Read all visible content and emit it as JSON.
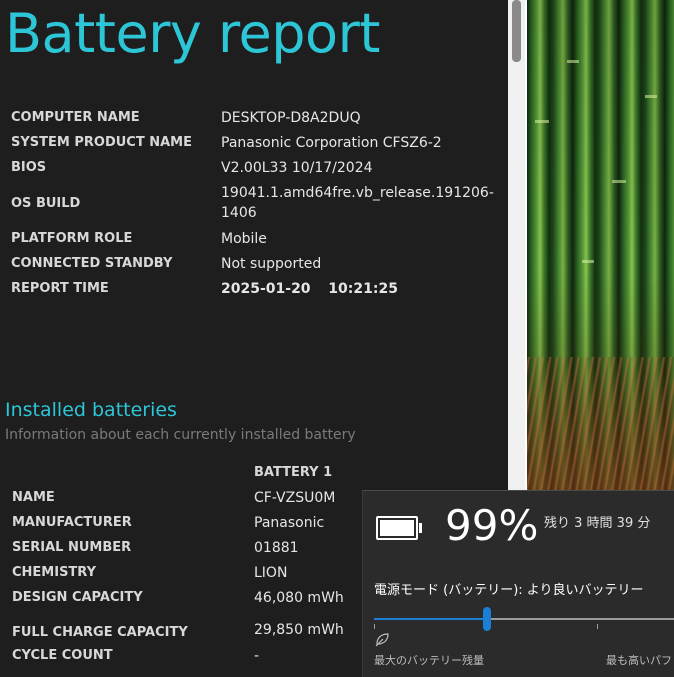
{
  "report": {
    "title": "Battery report",
    "system_info": [
      {
        "label": "COMPUTER NAME",
        "value": "DESKTOP-D8A2DUQ"
      },
      {
        "label": "SYSTEM PRODUCT NAME",
        "value": "Panasonic Corporation CFSZ6-2"
      },
      {
        "label": "BIOS",
        "value": "V2.00L33 10/17/2024"
      },
      {
        "label": "OS BUILD",
        "value": "19041.1.amd64fre.vb_release.191206-1406"
      },
      {
        "label": "PLATFORM ROLE",
        "value": "Mobile"
      },
      {
        "label": "CONNECTED STANDBY",
        "value": "Not supported"
      },
      {
        "label": "REPORT TIME",
        "value": "2025-01-20  10:21:25"
      }
    ],
    "installed_batteries": {
      "title": "Installed batteries",
      "subtitle": "Information about each currently installed battery",
      "column_header": "BATTERY 1",
      "rows": [
        {
          "label": "NAME",
          "value": "CF-VZSU0M"
        },
        {
          "label": "MANUFACTURER",
          "value": "Panasonic"
        },
        {
          "label": "SERIAL NUMBER",
          "value": "01881"
        },
        {
          "label": "CHEMISTRY",
          "value": "LION"
        },
        {
          "label": "DESIGN CAPACITY",
          "value": "46,080 mWh"
        },
        {
          "label": "FULL CHARGE CAPACITY",
          "value": "29,850 mWh"
        },
        {
          "label": "CYCLE COUNT",
          "value": "-"
        }
      ]
    }
  },
  "battery_flyout": {
    "percent": "99%",
    "percent_value": 0.99,
    "remaining": "残り 3 時間 39 分",
    "power_mode_label": "電源モード (バッテリー): より良いバッテリー",
    "slider_position": 0.375,
    "min_label": "最大のバッテリー残量",
    "max_label": "最も高いパフォ",
    "icons": [
      "battery-icon",
      "leaf-icon"
    ],
    "accent_color": "#1c7fd6"
  },
  "colors": {
    "title": "#2dc6d6",
    "background": "#1e1e1e"
  }
}
